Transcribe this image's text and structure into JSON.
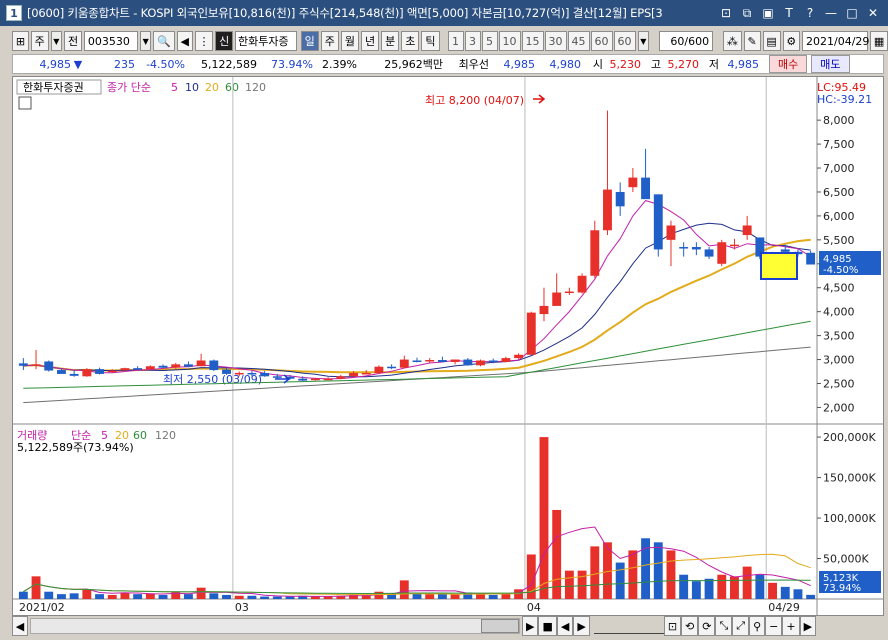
{
  "window": {
    "number": "1",
    "title": "[0600] 키움종합차트 - KOSPI 외국인보유[10,816(천)] 주식수[214,548(천)] 액면[5,000] 자본금[10,727(억)] 결산[12월] EPS[3"
  },
  "toolbar": {
    "type_label": "주",
    "prev_label": "전",
    "code": "003530",
    "credit_label": "신",
    "name": "한화투자증",
    "periods": [
      "일",
      "주",
      "월",
      "년",
      "분",
      "초",
      "틱"
    ],
    "active_period": "일",
    "intervals": [
      "1",
      "3",
      "5",
      "10",
      "15",
      "30",
      "45",
      "60",
      "60"
    ],
    "count": "60/600",
    "date": "2021/04/29"
  },
  "quote": {
    "price": "4,985",
    "change": "235",
    "change_pct": "-4.50%",
    "volume": "5,122,589",
    "volume_ratio": "73.94%",
    "turnover": "2.39%",
    "amount": "25,962백만",
    "best_ask_label": "최우선",
    "best_ask": "4,985",
    "best_bid": "4,980",
    "open_label": "시",
    "open": "5,230",
    "high_label": "고",
    "high": "5,270",
    "low_label": "저",
    "low": "4,985",
    "buy_label": "매수",
    "sell_label": "매도"
  },
  "legend": {
    "stock": "한화투자증권",
    "price_ma": "종가 단순",
    "ma_periods": [
      "5",
      "10",
      "20",
      "60",
      "120"
    ],
    "volume_label": "거래량",
    "volume_ma": "단순",
    "volume_value": "5,122,589주(73.94%)"
  },
  "annotations": {
    "high": "최고 8,200 (04/07)",
    "low": "최저 2,550 (03/09)",
    "lc": "LC:95.49",
    "hc": "HC:-39.21",
    "current_price": "4,985",
    "current_pct": "-4.50%",
    "vol_current": "5,123K",
    "vol_pct": "73.94%"
  },
  "colors": {
    "up": "#e8302a",
    "down": "#1f5fc7",
    "ma5": "#c21fa8",
    "ma10": "#1e2f8a",
    "ma20": "#e3ab1c",
    "ma60": "#2f8f3a",
    "ma120": "#707070"
  },
  "chart_data": {
    "type": "candlestick",
    "price_axis": [
      "8,000",
      "7,500",
      "7,000",
      "6,500",
      "6,000",
      "5,500",
      "5,000",
      "4,500",
      "4,000",
      "3,500",
      "3,000",
      "2,500",
      "2,000"
    ],
    "ylim": [
      1800,
      8400
    ],
    "volume_axis": [
      "200,000K",
      "150,000K",
      "100,000K",
      "50,000K"
    ],
    "volume_ylim": [
      0,
      210000
    ],
    "x_labels": [
      {
        "i": 0,
        "label": "2021/02"
      },
      {
        "i": 17,
        "label": "03"
      },
      {
        "i": 40,
        "label": "04"
      },
      {
        "i": 59,
        "label": "04/29"
      }
    ],
    "candles": [
      [
        2920,
        3030,
        2870,
        2780,
        9000
      ],
      [
        2900,
        3200,
        2900,
        2800,
        28000
      ],
      [
        2960,
        2980,
        2770,
        2750,
        9000
      ],
      [
        2780,
        2820,
        2700,
        2700,
        6000
      ],
      [
        2700,
        2780,
        2660,
        2640,
        7000
      ],
      [
        2650,
        2820,
        2800,
        2640,
        12000
      ],
      [
        2800,
        2830,
        2700,
        2690,
        6000
      ],
      [
        2740,
        2800,
        2770,
        2720,
        5000
      ],
      [
        2780,
        2830,
        2820,
        2750,
        8000
      ],
      [
        2820,
        2860,
        2800,
        2780,
        6000
      ],
      [
        2800,
        2880,
        2860,
        2790,
        7000
      ],
      [
        2870,
        2900,
        2830,
        2820,
        5000
      ],
      [
        2830,
        2930,
        2900,
        2810,
        9000
      ],
      [
        2900,
        2960,
        2850,
        2840,
        6000
      ],
      [
        2860,
        3120,
        2980,
        2860,
        14000
      ],
      [
        2980,
        3000,
        2780,
        2760,
        7000
      ],
      [
        2790,
        2820,
        2700,
        2680,
        5000
      ],
      [
        2700,
        2750,
        2720,
        2650,
        4000
      ],
      [
        2720,
        2760,
        2700,
        2650,
        4000
      ],
      [
        2720,
        2760,
        2650,
        2640,
        3000
      ],
      [
        2650,
        2700,
        2620,
        2600,
        3000
      ],
      [
        2640,
        2680,
        2600,
        2580,
        3000
      ],
      [
        2600,
        2650,
        2560,
        2550,
        4000
      ],
      [
        2580,
        2620,
        2600,
        2560,
        3000
      ],
      [
        2590,
        2630,
        2600,
        2570,
        3000
      ],
      [
        2600,
        2680,
        2650,
        2590,
        4000
      ],
      [
        2650,
        2760,
        2720,
        2640,
        6000
      ],
      [
        2700,
        2780,
        2720,
        2690,
        5000
      ],
      [
        2720,
        2880,
        2850,
        2700,
        9000
      ],
      [
        2850,
        2900,
        2830,
        2800,
        6000
      ],
      [
        2830,
        3080,
        3000,
        2820,
        23000
      ],
      [
        2980,
        3040,
        2970,
        2940,
        8000
      ],
      [
        2970,
        3030,
        2990,
        2930,
        6000
      ],
      [
        2990,
        3060,
        2950,
        2940,
        7000
      ],
      [
        2950,
        3000,
        3000,
        2900,
        6000
      ],
      [
        3000,
        3030,
        2880,
        2870,
        8000
      ],
      [
        2880,
        3000,
        2980,
        2860,
        7000
      ],
      [
        2980,
        3020,
        2950,
        2920,
        5000
      ],
      [
        2950,
        3060,
        3030,
        2940,
        7000
      ],
      [
        3030,
        3130,
        3100,
        3000,
        12000
      ],
      [
        3100,
        4000,
        3980,
        3100,
        55000
      ],
      [
        3950,
        4500,
        4120,
        3800,
        200000
      ],
      [
        4120,
        4800,
        4400,
        4300,
        110000
      ],
      [
        4400,
        4500,
        4420,
        4350,
        35000
      ],
      [
        4400,
        4800,
        4750,
        4380,
        35000
      ],
      [
        4750,
        5900,
        5700,
        4700,
        65000
      ],
      [
        5700,
        8200,
        6550,
        5600,
        70000
      ],
      [
        6500,
        6700,
        6200,
        6000,
        45000
      ],
      [
        6600,
        7000,
        6800,
        6500,
        60000
      ],
      [
        6800,
        7400,
        6350,
        6400,
        75000
      ],
      [
        6450,
        6450,
        5300,
        5150,
        70000
      ],
      [
        5500,
        5900,
        5800,
        4950,
        60000
      ],
      [
        5350,
        5450,
        5320,
        5150,
        30000
      ],
      [
        5350,
        5450,
        5300,
        5180,
        22000
      ],
      [
        5300,
        5350,
        5150,
        5100,
        25000
      ],
      [
        5000,
        5500,
        5450,
        4950,
        30000
      ],
      [
        5400,
        5520,
        5400,
        5300,
        28000
      ],
      [
        5600,
        6000,
        5800,
        5500,
        40000
      ],
      [
        5550,
        5550,
        5150,
        5100,
        30000
      ],
      [
        5180,
        5250,
        5180,
        5100,
        20000
      ],
      [
        5300,
        5400,
        5250,
        5180,
        15000
      ],
      [
        5250,
        5300,
        5200,
        5150,
        12000
      ],
      [
        5230,
        5270,
        4985,
        4985,
        5123
      ]
    ]
  }
}
